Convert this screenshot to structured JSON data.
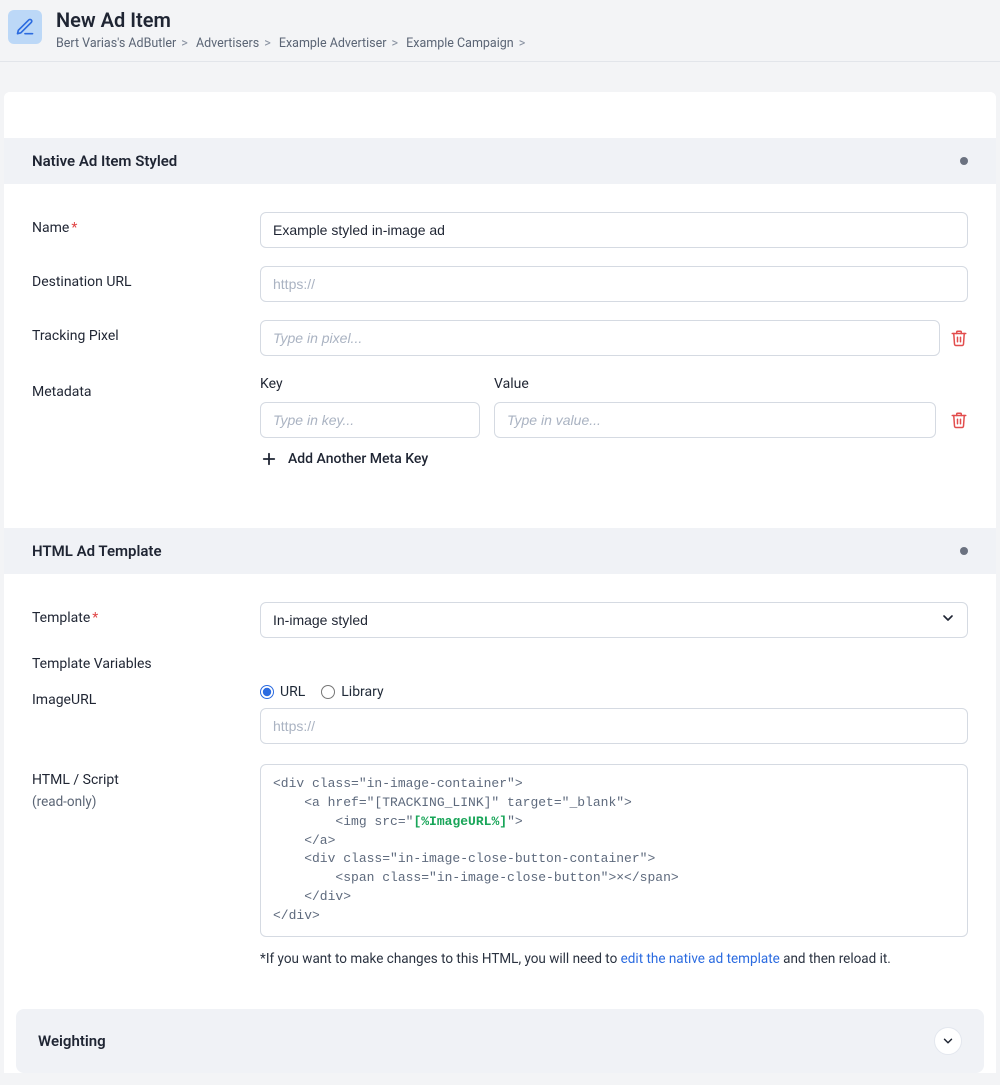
{
  "header": {
    "title": "New Ad Item",
    "breadcrumb": [
      "Bert Varias's AdButler",
      "Advertisers",
      "Example Advertiser",
      "Example Campaign"
    ]
  },
  "section_native": {
    "title": "Native Ad Item Styled",
    "name_label": "Name",
    "name_value": "Example styled in-image ad",
    "dest_label": "Destination URL",
    "dest_placeholder": "https://",
    "pixel_label": "Tracking Pixel",
    "pixel_placeholder": "Type in pixel...",
    "metadata_label": "Metadata",
    "meta_key_label": "Key",
    "meta_value_label": "Value",
    "meta_key_placeholder": "Type in key...",
    "meta_value_placeholder": "Type in value...",
    "add_meta_label": "Add Another Meta Key"
  },
  "section_template": {
    "title": "HTML Ad Template",
    "template_label": "Template",
    "template_value": "In-image styled",
    "vars_label": "Template Variables",
    "imageurl_label": "ImageURL",
    "radio_url": "URL",
    "radio_library": "Library",
    "imageurl_placeholder": "https://",
    "html_label": "HTML / Script",
    "html_sub": "(read-only)",
    "code_pre": "<div class=\"in-image-container\">\n    <a href=\"[TRACKING_LINK]\" target=\"_blank\">\n        <img src=\"",
    "code_hl": "[%ImageURL%]",
    "code_post": "\">\n    </a>\n    <div class=\"in-image-close-button-container\">\n        <span class=\"in-image-close-button\">×</span>\n    </div>\n</div>",
    "helper_pre": "*If you want to make changes to this HTML, you will need to ",
    "helper_link": "edit the native ad template",
    "helper_post": " and then reload it."
  },
  "section_weighting": {
    "title": "Weighting"
  }
}
